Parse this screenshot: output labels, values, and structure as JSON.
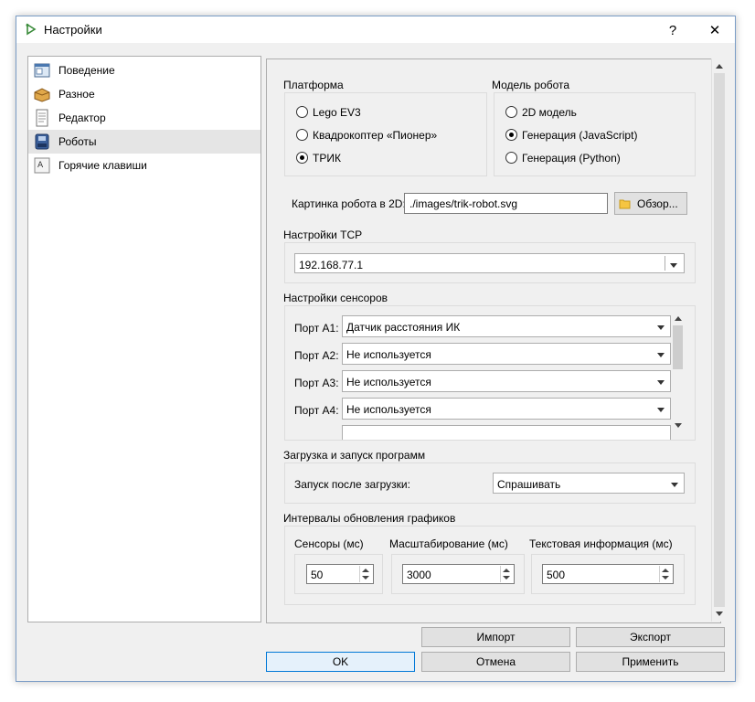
{
  "window": {
    "title": "Настройки",
    "help_label": "?",
    "close_label": "✕"
  },
  "sidebar": {
    "items": [
      {
        "label": "Поведение",
        "icon": "behavior-icon"
      },
      {
        "label": "Разное",
        "icon": "misc-icon"
      },
      {
        "label": "Редактор",
        "icon": "editor-icon"
      },
      {
        "label": "Роботы",
        "icon": "robots-icon"
      },
      {
        "label": "Горячие клавиши",
        "icon": "hotkeys-icon"
      }
    ],
    "selected": "Роботы"
  },
  "platform": {
    "title": "Платформа",
    "options": [
      "Lego EV3",
      "Квадрокоптер «Пионер»",
      "ТРИК"
    ],
    "selected": "ТРИК"
  },
  "model": {
    "title": "Модель робота",
    "options": [
      "2D модель",
      "Генерация (JavaScript)",
      "Генерация (Python)"
    ],
    "selected": "Генерация (JavaScript)"
  },
  "image2d": {
    "label": "Картинка робота в 2D:",
    "value": "./images/trik-robot.svg",
    "browse_label": "Обзор..."
  },
  "tcp": {
    "title": "Настройки TCP",
    "value": "192.168.77.1"
  },
  "sensors": {
    "title": "Настройки сенсоров",
    "ports": [
      {
        "label": "Порт A1:",
        "value": "Датчик расстояния ИК"
      },
      {
        "label": "Порт A2:",
        "value": "Не используется"
      },
      {
        "label": "Порт A3:",
        "value": "Не используется"
      },
      {
        "label": "Порт A4:",
        "value": "Не используется"
      }
    ]
  },
  "upload": {
    "title": "Загрузка и запуск программ",
    "label": "Запуск после загрузки:",
    "value": "Спрашивать"
  },
  "intervals": {
    "title": "Интервалы обновления графиков",
    "sensors_label": "Сенсоры  (мс)",
    "sensors_value": "50",
    "scaling_label": "Масштабирование  (мс)",
    "scaling_value": "3000",
    "text_label": "Текстовая информация (мс)",
    "text_value": "500"
  },
  "buttons": {
    "import": "Импорт",
    "export": "Экспорт",
    "ok": "OK",
    "cancel": "Отмена",
    "apply": "Применить"
  },
  "colors": {
    "accent": "#0078d7",
    "selected_item_bg": "#e5e5e5",
    "folder": "#f5c542"
  }
}
